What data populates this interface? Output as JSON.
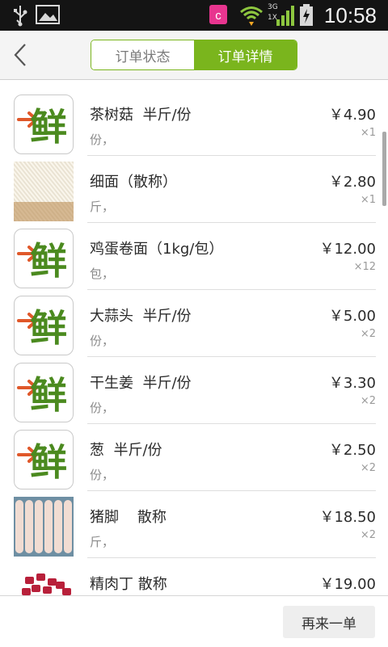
{
  "status_bar": {
    "time": "10:58",
    "network": "3G",
    "icons": [
      "usb-icon",
      "image-icon",
      "app-c-icon",
      "wifi-icon",
      "signal-icon",
      "battery-charging-icon"
    ]
  },
  "header": {
    "back_icon": "chevron-left-icon",
    "tabs": [
      {
        "label": "订单状态",
        "active": false
      },
      {
        "label": "订单详情",
        "active": true
      }
    ]
  },
  "colors": {
    "accent": "#7ab51d",
    "logo_green": "#4b8a1f",
    "logo_orange": "#e0582a"
  },
  "items": [
    {
      "name": "茶树菇  半斤/份",
      "unit": "份，",
      "price": "￥4.90",
      "qty": "×1",
      "image": "logo"
    },
    {
      "name": "细面（散称）",
      "unit": "斤，",
      "price": "￥2.80",
      "qty": "×1",
      "image": "noodles"
    },
    {
      "name": "鸡蛋卷面（1kg/包）",
      "unit": "包，",
      "price": "￥12.00",
      "qty": "×12",
      "image": "logo"
    },
    {
      "name": "大蒜头  半斤/份",
      "unit": "份，",
      "price": "￥5.00",
      "qty": "×2",
      "image": "logo"
    },
    {
      "name": "干生姜  半斤/份",
      "unit": "份，",
      "price": "￥3.30",
      "qty": "×2",
      "image": "logo"
    },
    {
      "name": "葱  半斤/份",
      "unit": "份，",
      "price": "￥2.50",
      "qty": "×2",
      "image": "logo"
    },
    {
      "name": "猪脚    散称",
      "unit": "斤，",
      "price": "￥18.50",
      "qty": "×2",
      "image": "trotters"
    },
    {
      "name": "精肉丁 散称",
      "unit": "",
      "price": "￥19.00",
      "qty": "",
      "image": "meat"
    }
  ],
  "footer": {
    "reorder_label": "再来一单"
  }
}
